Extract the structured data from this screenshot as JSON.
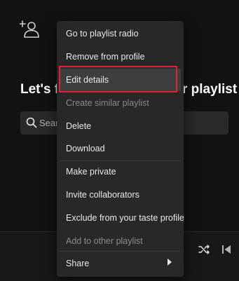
{
  "heading": {
    "left": "Let's fi",
    "right": "r playlist"
  },
  "search": {
    "placeholder": "Sear"
  },
  "context_menu": {
    "items": [
      {
        "label": "Go to playlist radio",
        "disabled": false
      },
      {
        "label": "Remove from profile",
        "disabled": false
      },
      {
        "label": "Edit details",
        "disabled": false,
        "highlighted": true
      },
      {
        "label": "Create similar playlist",
        "disabled": true
      },
      {
        "label": "Delete",
        "disabled": false
      },
      {
        "label": "Download",
        "disabled": false
      },
      {
        "label": "Make private",
        "disabled": false
      },
      {
        "label": "Invite collaborators",
        "disabled": false
      },
      {
        "label": "Exclude from your taste profile",
        "disabled": false
      },
      {
        "label": "Add to other playlist",
        "disabled": true
      },
      {
        "label": "Share",
        "disabled": false,
        "has_submenu": true
      }
    ]
  },
  "icons": {
    "add_user": "add-user-icon",
    "search": "search-icon",
    "shuffle": "shuffle-icon",
    "previous": "previous-icon",
    "submenu": "chevron-right-icon"
  },
  "colors": {
    "background": "#121212",
    "menu_background": "#282828",
    "menu_hover": "#3e3e3e",
    "annotation_highlight": "#e0252b",
    "disabled_text": "#8a8a8a"
  }
}
